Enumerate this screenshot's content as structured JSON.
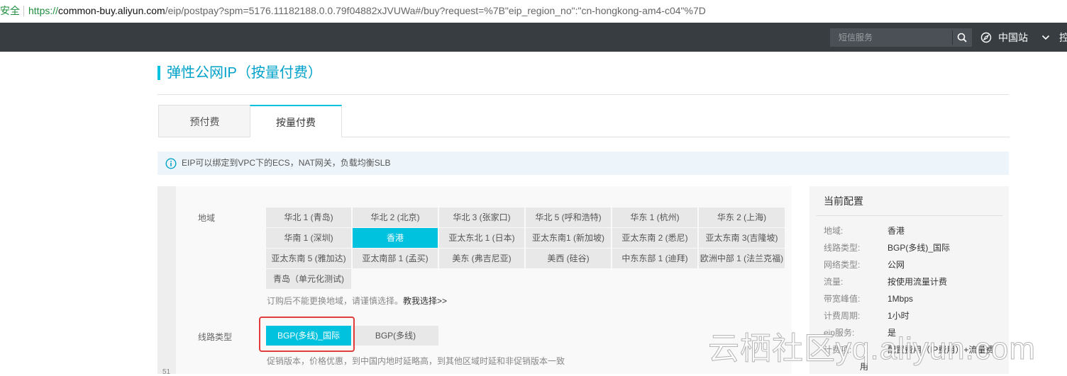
{
  "browser": {
    "security_label": "安全",
    "url_protocol": "https://",
    "url_host": "common-buy.aliyun.com",
    "url_path": "/eip/postpay?spm=5176.11182188.0.0.79f04882xJVUWa#/buy?request=%7B\"eip_region_no\":\"cn-hongkong-am4-c04\"%7D"
  },
  "topnav": {
    "search_placeholder": "短信服务",
    "region_label": "中国站",
    "more_label": "控"
  },
  "page": {
    "title": "弹性公网IP（按量付费）",
    "tabs": [
      {
        "label": "预付费",
        "active": false
      },
      {
        "label": "按量付费",
        "active": true
      }
    ],
    "notice": "EIP可以绑定到VPC下的ECS，NAT网关，负载均衡SLB"
  },
  "config": {
    "region_label": "地域",
    "regions": [
      "华北 1 (青岛)",
      "华北 2 (北京)",
      "华北 3 (张家口)",
      "华北 5 (呼和浩特)",
      "华东 1 (杭州)",
      "华东 2 (上海)",
      "华南 1 (深圳)",
      "香港",
      "亚太东北 1 (日本)",
      "亚太东南1 (新加坡)",
      "亚太东南 2 (悉尼)",
      "亚太东南 3(吉隆坡)",
      "亚太东南 5 (雅加达)",
      "亚太南部 1 (孟买)",
      "美东 (弗吉尼亚)",
      "美西 (硅谷)",
      "中东东部 1 (迪拜)",
      "欧洲中部 1 (法兰克福)",
      "青岛（单元化测试)"
    ],
    "selected_region": "香港",
    "region_hint": "订购后不能更换地域，请谨慎选择。",
    "region_hint_link": "教我选择>>",
    "line_label": "线路类型",
    "lines": [
      "BGP(多线)_国际",
      "BGP(多线)"
    ],
    "selected_line": "BGP(多线)_国际",
    "line_hint": "促销版本，价格优惠，到中国内地时延略高，到其他区域时延和非促销版本一致",
    "gutter_text": "51"
  },
  "summary": {
    "title": "当前配置",
    "rows": [
      {
        "label": "地域:",
        "value": "香港"
      },
      {
        "label": "线路类型:",
        "value": "BGP(多线)_国际"
      },
      {
        "label": "网络类型:",
        "value": "公网"
      },
      {
        "label": "流量:",
        "value": "按使用流量计费"
      },
      {
        "label": "带宽峰值:",
        "value": "1Mbps"
      },
      {
        "label": "计费周期:",
        "value": "1小时"
      },
      {
        "label": "eip服务:",
        "value": "是"
      },
      {
        "label": "计费项:",
        "value": "配置费用（IP费用）+流量费"
      }
    ],
    "overflow_text": "用"
  },
  "watermark": "云栖社区yq.aliyun.com",
  "colors": {
    "accent": "#00c1de",
    "title": "#00a2ca",
    "topnav": "#373d41",
    "highlight_box": "#e23d3d"
  }
}
